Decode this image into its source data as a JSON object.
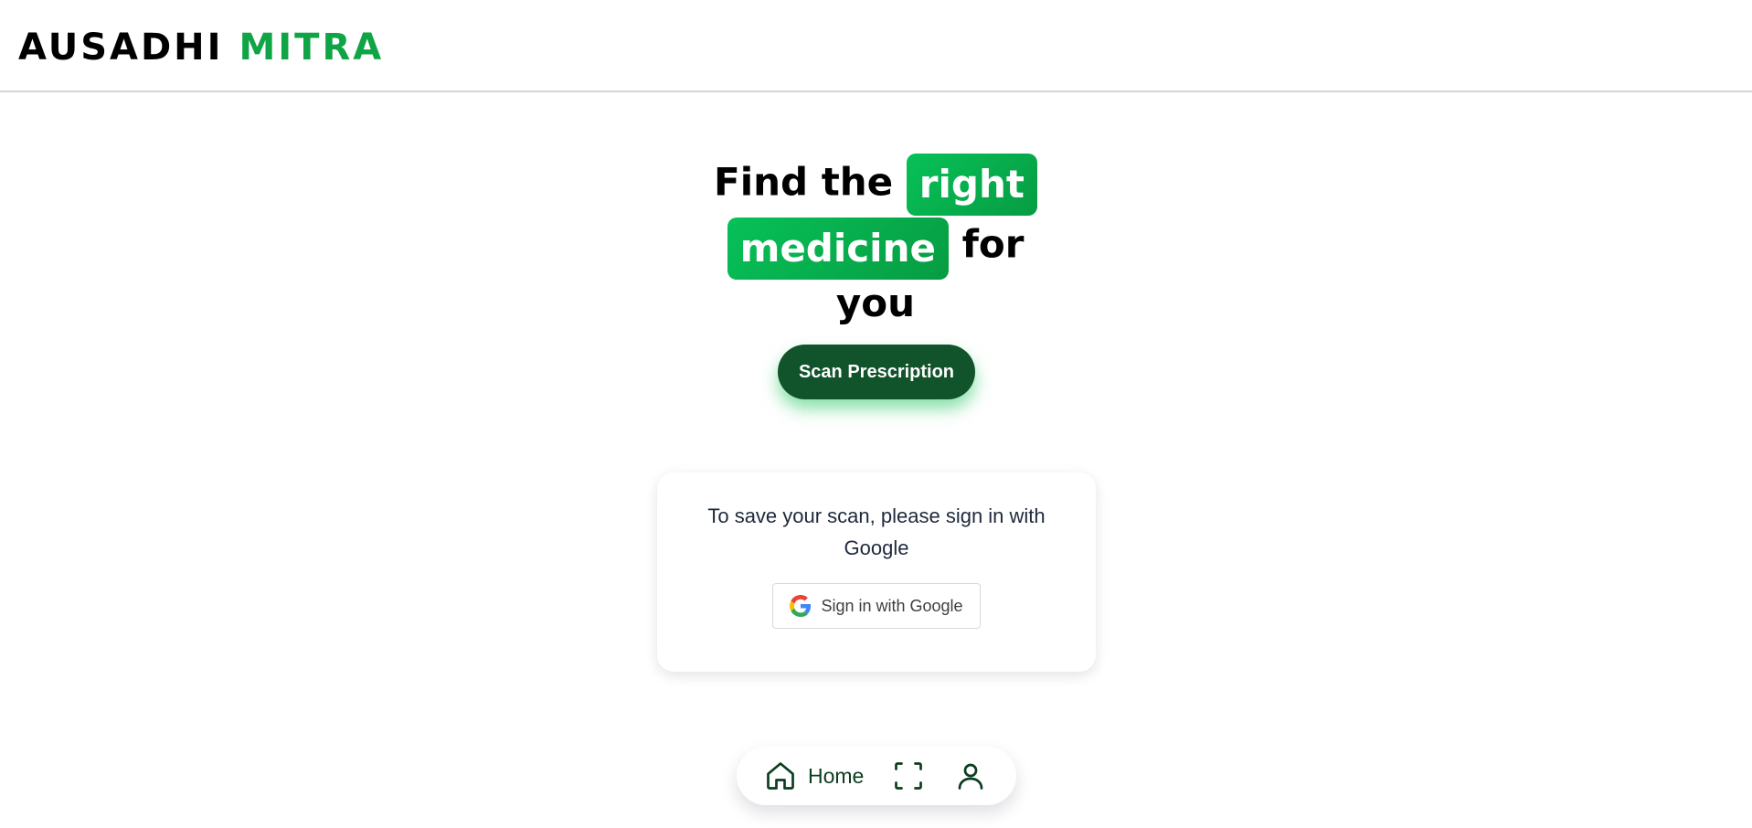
{
  "header": {
    "logo_part1": "AUSADHI",
    "logo_part2": "MITRA"
  },
  "hero": {
    "prefix": "Find the",
    "highlight1": "right",
    "highlight2": "medicine",
    "middle": "for",
    "suffix": "you"
  },
  "actions": {
    "scan_label": "Scan Prescription"
  },
  "signin_card": {
    "message": "To save your scan, please sign in with Google",
    "google_button_label": "Sign in with Google"
  },
  "bottom_nav": {
    "home_label": "Home",
    "items": [
      {
        "icon": "home-icon"
      },
      {
        "icon": "scan-frame-icon"
      },
      {
        "icon": "user-icon"
      }
    ]
  },
  "colors": {
    "brand_green": "#0fa445",
    "dark_green": "#11532a",
    "highlight_green": "#07c158"
  }
}
